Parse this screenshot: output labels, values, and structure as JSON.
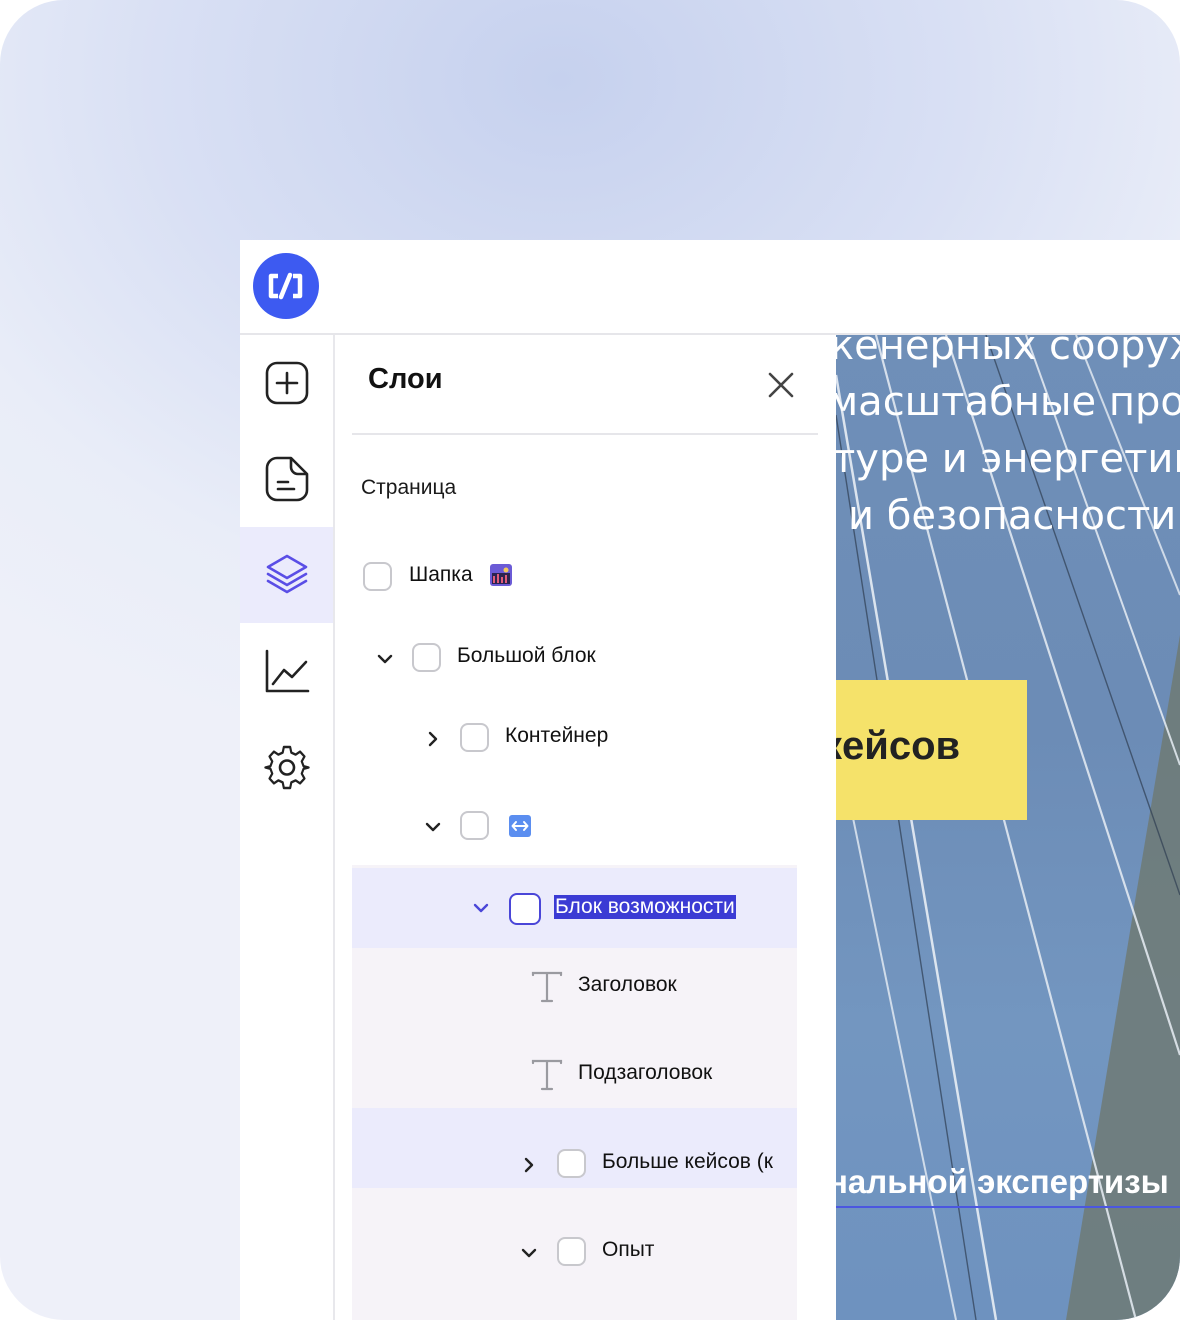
{
  "app": {
    "logo_text": "c/]"
  },
  "rail": {
    "items": [
      {
        "name": "add",
        "icon": "plus-square-icon"
      },
      {
        "name": "pages",
        "icon": "page-icon"
      },
      {
        "name": "layers",
        "icon": "layers-icon",
        "active": true
      },
      {
        "name": "analytics",
        "icon": "chart-line-icon"
      },
      {
        "name": "settings",
        "icon": "gear-icon"
      }
    ]
  },
  "panel": {
    "title": "Слои",
    "section": "Страница",
    "layers": [
      {
        "label": "Шапка",
        "icon": "image-emoji-icon",
        "level": 0,
        "expand": "none"
      },
      {
        "label": "Большой блок",
        "level": 0,
        "expand": "open"
      },
      {
        "label": "Контейнер",
        "level": 1,
        "expand": "closed"
      },
      {
        "label": "",
        "icon": "left-right-arrow-emoji-icon",
        "level": 1,
        "expand": "open"
      },
      {
        "label": "Блок возможности",
        "level": 2,
        "expand": "open",
        "selected": true
      },
      {
        "label": "Заголовок",
        "level": 3,
        "type": "text"
      },
      {
        "label": "Подзаголовок",
        "level": 3,
        "type": "text"
      },
      {
        "label": "Больше кейсов (к",
        "level": 3,
        "expand": "closed"
      },
      {
        "label": "Опыт",
        "level": 3,
        "expand": "open"
      }
    ]
  },
  "preview": {
    "lines": [
      "кенерных сооруж",
      "масштабные проє",
      "туре и энергетик",
      "и безопасности."
    ],
    "button_label": "кейсов",
    "subheading": "нальной экспертизы"
  },
  "colors": {
    "brand": "#3d5af1",
    "selection_bg": "#ebebfc",
    "selection_text_bg": "#3b3bd4",
    "cta_yellow": "#f5e26a"
  }
}
